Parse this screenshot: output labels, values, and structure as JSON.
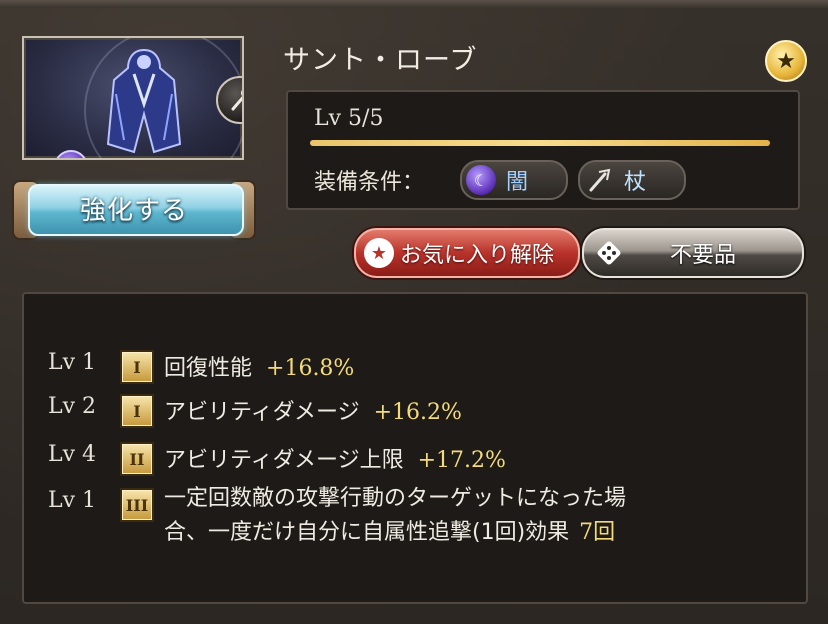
{
  "item": {
    "name": "サント・ローブ",
    "level_label": "Lv 5/5",
    "level_fraction": 1.0,
    "element_icon": "dark-element-icon",
    "weapon_icon": "staff-icon",
    "favorite_icon": "star-icon"
  },
  "enhance_button": {
    "label": "強化する"
  },
  "requirements": {
    "label": "装備条件：",
    "element": {
      "label": "闇",
      "icon": "dark-element-icon"
    },
    "weapon": {
      "label": "杖",
      "icon": "staff-icon"
    }
  },
  "actions": {
    "unfavorite_label": "お気に入り解除",
    "unfavorite_icon": "star-icon",
    "unneeded_label": "不要品",
    "unneeded_icon": "dice-icon"
  },
  "skills": [
    {
      "lv": "Lv 1",
      "tier": "I",
      "name": "回復性能",
      "value": "+16.8%"
    },
    {
      "lv": "Lv 2",
      "tier": "I",
      "name": "アビリティダメージ",
      "value": "+16.2%"
    },
    {
      "lv": "Lv 4",
      "tier": "II",
      "name": "アビリティダメージ上限",
      "value": "+17.2%"
    },
    {
      "lv": "Lv 1",
      "tier": "III",
      "name_line1": "一定回数敵の攻撃行動のターゲットになった場",
      "name_line2": "合、一度だけ自分に自属性追撃(1回)効果",
      "value": "7回"
    }
  ],
  "colors": {
    "accent_gold": "#f3db7b",
    "enhance_button": "#5eb6cf",
    "unfavorite_button": "#b8322a"
  }
}
